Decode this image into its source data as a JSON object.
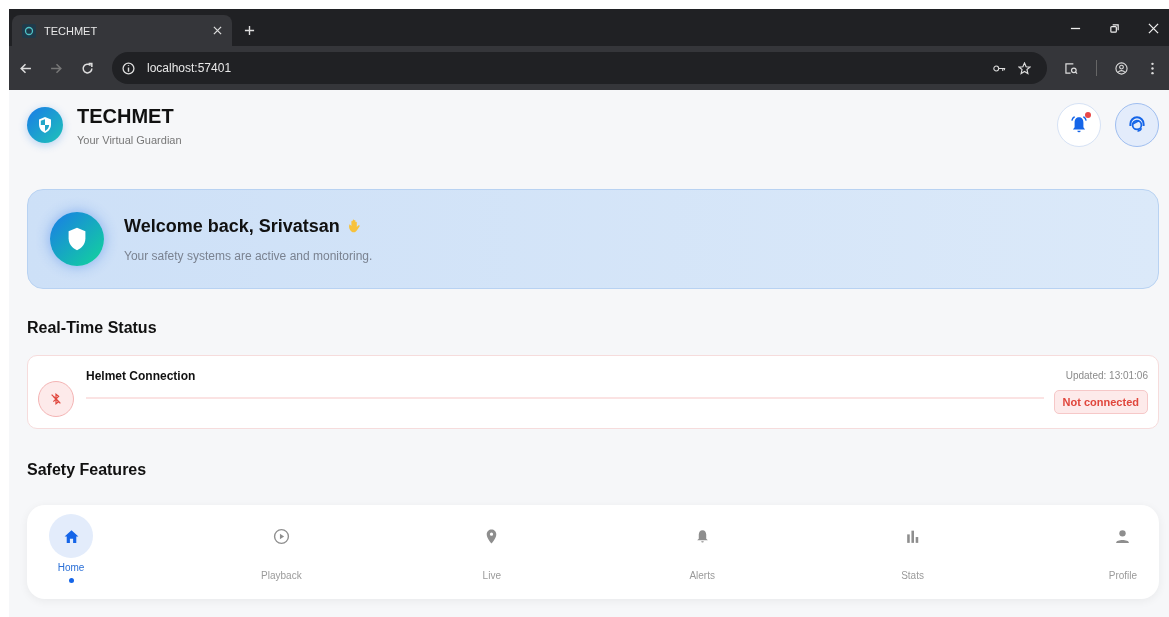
{
  "browser": {
    "tab_title": "TECHMET",
    "url": "localhost:57401"
  },
  "header": {
    "title": "TECHMET",
    "subtitle": "Your Virtual Guardian",
    "notification_unread": true
  },
  "welcome": {
    "title": "Welcome back, Srivatsan",
    "subtitle": "Your safety systems are active and monitoring."
  },
  "real_time_status": {
    "heading": "Real-Time Status",
    "cards": [
      {
        "title": "Helmet Connection",
        "updated": "Updated: 13:01:06",
        "status": "Not connected",
        "connected": false
      }
    ]
  },
  "safety_features": {
    "heading": "Safety Features"
  },
  "bottom_nav": [
    {
      "kind": "home",
      "label": "Home",
      "selected": true
    },
    {
      "kind": "playback",
      "label": "Playback",
      "selected": false
    },
    {
      "kind": "live",
      "label": "Live",
      "selected": false
    },
    {
      "kind": "alerts",
      "label": "Alerts",
      "selected": false
    },
    {
      "kind": "stats",
      "label": "Stats",
      "selected": false
    },
    {
      "kind": "profile",
      "label": "Profile",
      "selected": false
    }
  ]
}
